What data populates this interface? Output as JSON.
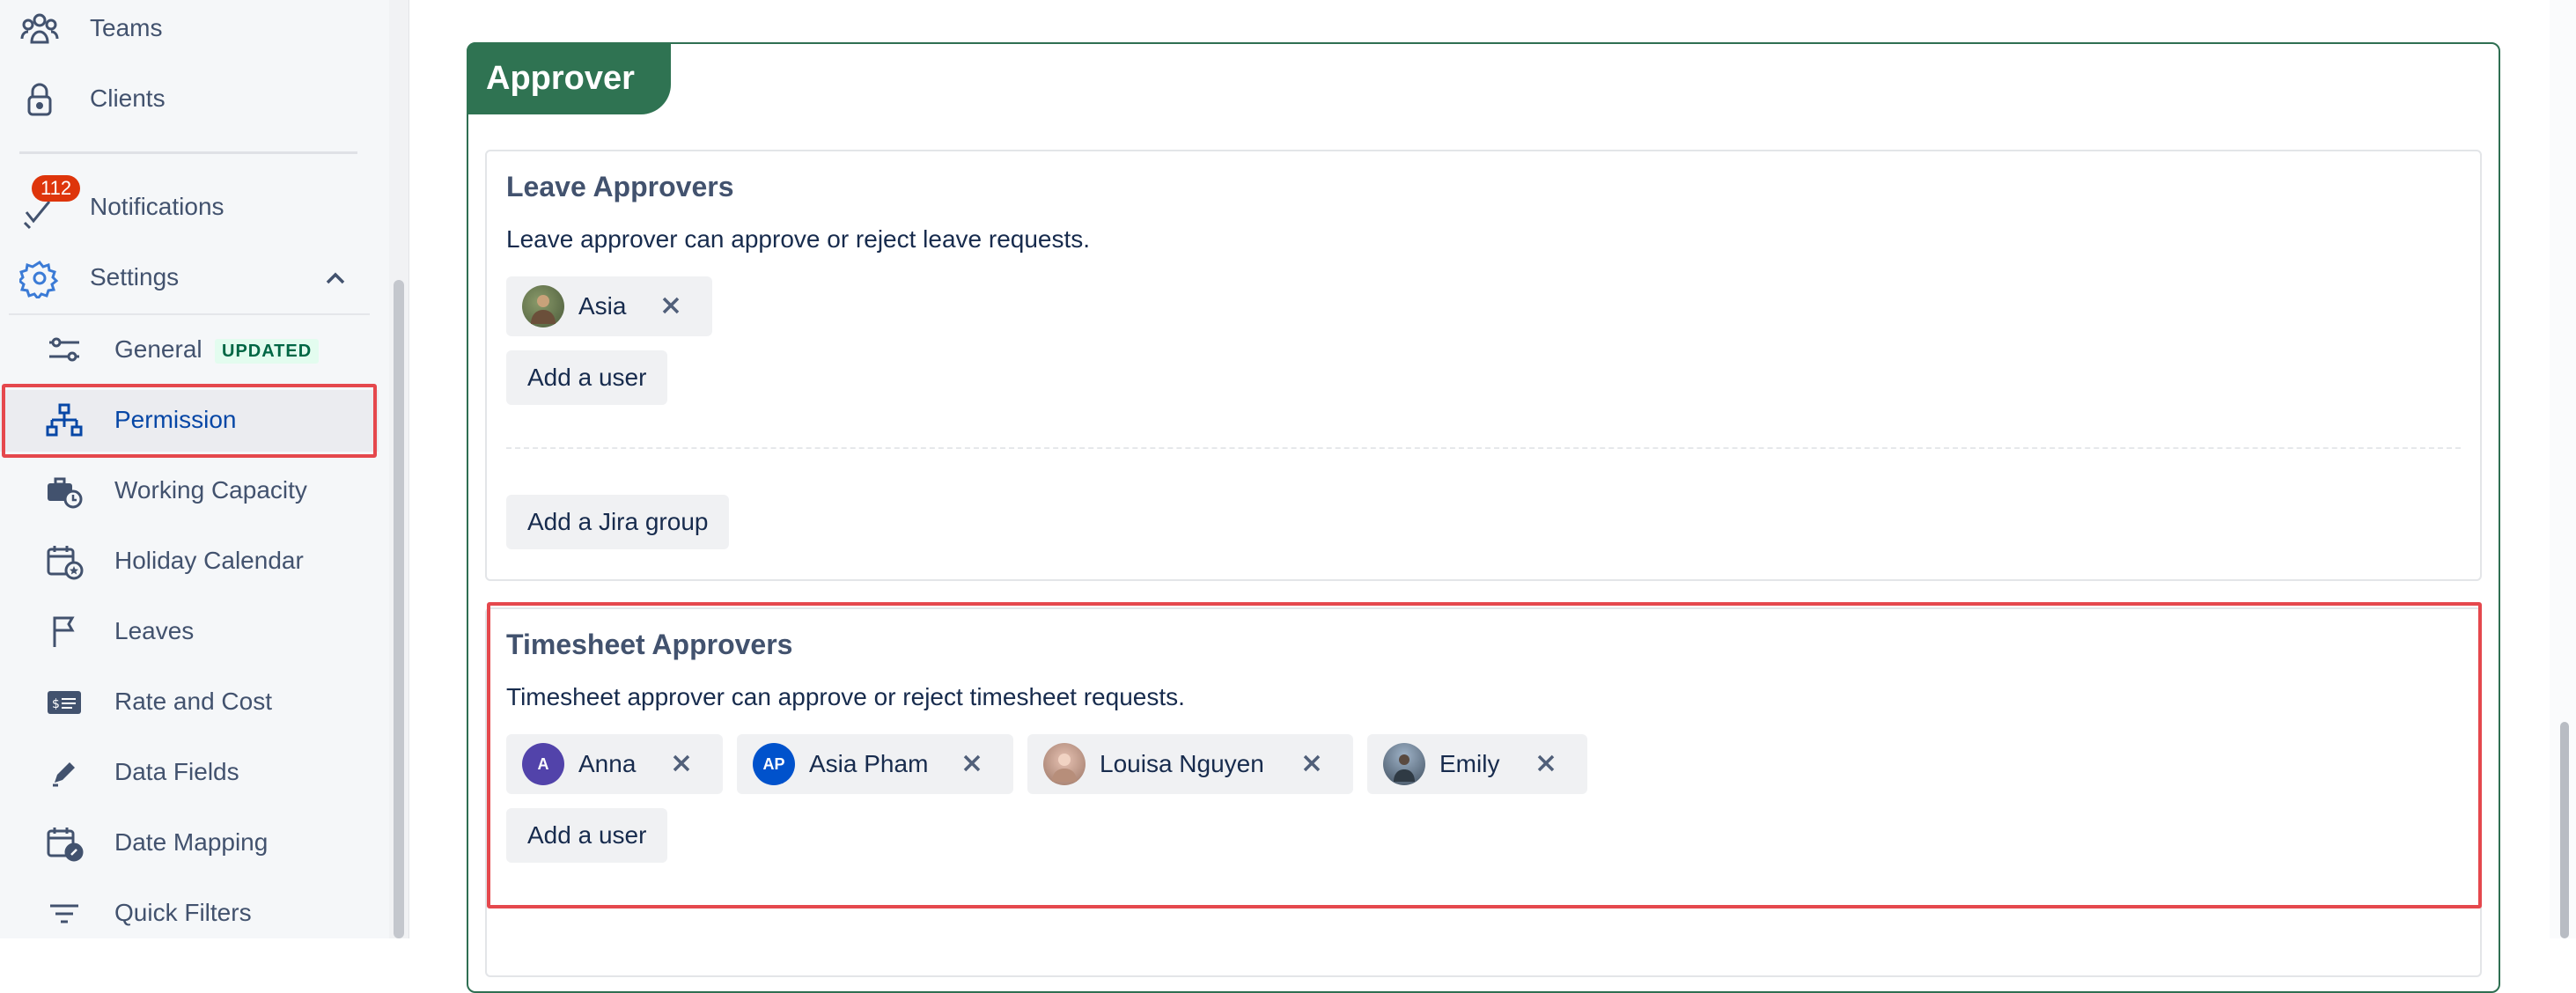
{
  "sidebar": {
    "items": [
      {
        "key": "teams",
        "label": "Teams",
        "icon": "teams-icon"
      },
      {
        "key": "clients",
        "label": "Clients",
        "icon": "lock-icon"
      },
      {
        "key": "notifications",
        "label": "Notifications",
        "icon": "notification-icon",
        "badge": "112"
      },
      {
        "key": "settings",
        "label": "Settings",
        "icon": "gear-icon",
        "expanded": true
      }
    ],
    "settings_items": [
      {
        "key": "general",
        "label": "General",
        "icon": "sliders-icon",
        "tag": "UPDATED"
      },
      {
        "key": "permission",
        "label": "Permission",
        "icon": "hierarchy-icon",
        "active": true
      },
      {
        "key": "working_capacity",
        "label": "Working Capacity",
        "icon": "briefcase-clock-icon"
      },
      {
        "key": "holiday_calendar",
        "label": "Holiday Calendar",
        "icon": "calendar-star-icon"
      },
      {
        "key": "leaves",
        "label": "Leaves",
        "icon": "flag-icon"
      },
      {
        "key": "rate_and_cost",
        "label": "Rate and Cost",
        "icon": "money-card-icon"
      },
      {
        "key": "data_fields",
        "label": "Data Fields",
        "icon": "pencil-icon"
      },
      {
        "key": "date_mapping",
        "label": "Date Mapping",
        "icon": "calendar-link-icon"
      },
      {
        "key": "quick_filters",
        "label": "Quick Filters",
        "icon": "filter-icon"
      }
    ]
  },
  "main": {
    "approver_tab": "Approver",
    "leave": {
      "title": "Leave Approvers",
      "description": "Leave approver can approve or reject leave requests.",
      "users": [
        {
          "name": "Asia",
          "avatar": "photo"
        }
      ],
      "add_user_label": "Add a user",
      "add_group_label": "Add a Jira group"
    },
    "timesheet": {
      "title": "Timesheet Approvers",
      "description": "Timesheet approver can approve or reject timesheet requests.",
      "users": [
        {
          "name": "Anna",
          "avatar": "initials",
          "initials": "A",
          "color": "#5243aa"
        },
        {
          "name": "Asia Pham",
          "avatar": "initials",
          "initials": "AP",
          "color": "#0052cc"
        },
        {
          "name": "Louisa Nguyen",
          "avatar": "photo"
        },
        {
          "name": "Emily",
          "avatar": "photo"
        }
      ],
      "add_user_label": "Add a user"
    }
  },
  "colors": {
    "accent_green": "#2f7352",
    "highlight_red": "#e5484d",
    "active_blue": "#0747a6",
    "badge_red": "#de350b"
  }
}
